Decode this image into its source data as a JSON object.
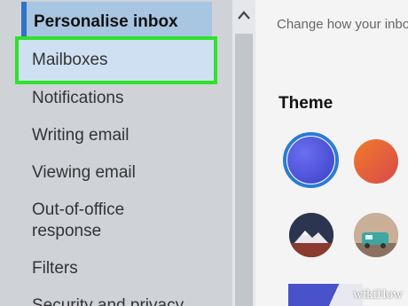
{
  "sidebar": {
    "header": "Personalise inbox",
    "selected_item": "Mailboxes",
    "items": [
      {
        "label": "Notifications"
      },
      {
        "label": "Writing email"
      },
      {
        "label": "Viewing email"
      },
      {
        "label": "Out-of-office"
      },
      {
        "label": "response"
      },
      {
        "label": "Filters"
      },
      {
        "label": "Security and privacy"
      }
    ]
  },
  "main": {
    "description": "Change how your inbox looks",
    "theme_heading": "Theme"
  },
  "colors": {
    "highlight_border": "#2fe22a",
    "selected_theme_ring": "#2a7bd6",
    "header_accent": "#2f73c4"
  },
  "watermark": "wikiHow"
}
